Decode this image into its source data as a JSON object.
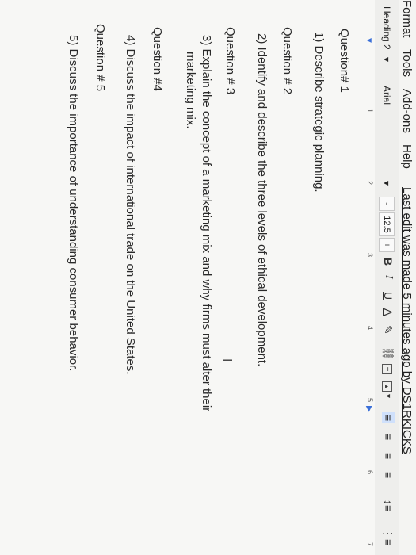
{
  "menu": {
    "format": "Format",
    "tools": "Tools",
    "addons": "Add-ons",
    "help": "Help",
    "last_edit": "Last edit was made 5 minutes ago by DS1RKICKS"
  },
  "toolbar": {
    "style": "Heading 2",
    "font": "Arial",
    "minus": "-",
    "font_size": "12.5",
    "plus": "+",
    "bold": "B",
    "italic": "I",
    "underline": "U",
    "text_color": "A"
  },
  "ruler": [
    "1",
    "2",
    "3",
    "4",
    "5",
    "6",
    "7"
  ],
  "doc": {
    "q1": "Question# 1",
    "a1": "1)  Describe strategic planning.",
    "q2": "Question # 2",
    "a2": "2)  Identify and describe the three levels of ethical development.",
    "q3": "Question # 3",
    "a3_line1": "3)  Explain the concept of a marketing mix and why firms must alter their",
    "a3_line2": "marketing mix.",
    "q4": "Question #4",
    "a4": "4)  Discuss the impact of international trade on the United States.",
    "q5": "Question # 5",
    "a5": "5)  Discuss the importance of understanding consumer behavior."
  }
}
